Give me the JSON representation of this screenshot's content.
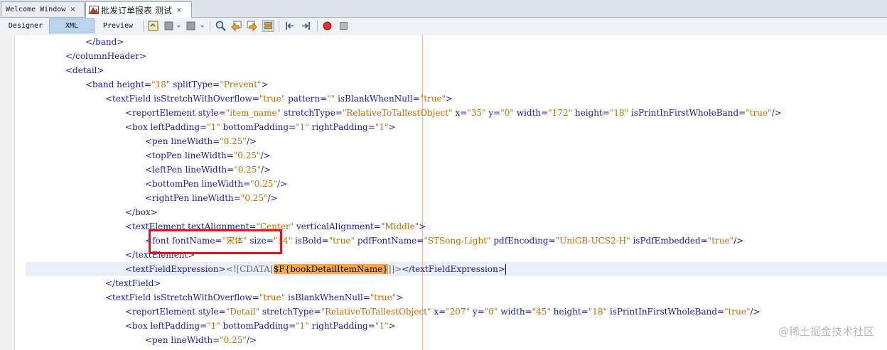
{
  "tabs": [
    {
      "label": "Welcome Window",
      "close": "×",
      "icon": ""
    },
    {
      "label": "批发订单报表 测试",
      "close": "×",
      "icon": "report-icon"
    }
  ],
  "view_buttons": [
    "Designer",
    "XML",
    "Preview"
  ],
  "selected_view": "XML",
  "toolbar_icons": [
    "source-icon",
    "insert-icon",
    "insert-dropdown-icon",
    "insert2-icon",
    "insert2-dropdown-icon",
    "find-icon",
    "find-prev-icon",
    "find-next-icon",
    "toggle-highlight-icon",
    "shift-left-icon",
    "shift-right-icon",
    "record-macro-icon",
    "stop-macro-icon"
  ],
  "code_lines": [
    {
      "indent": "            ",
      "parts": [
        [
          "t",
          "</band>"
        ]
      ]
    },
    {
      "indent": "        ",
      "parts": [
        [
          "t",
          "</columnHeader>"
        ]
      ]
    },
    {
      "indent": "        ",
      "parts": [
        [
          "t",
          "<detail>"
        ]
      ]
    },
    {
      "indent": "            ",
      "parts": [
        [
          "t",
          "<band "
        ],
        [
          "a",
          "height="
        ],
        [
          "v",
          "\"18\""
        ],
        [
          "a",
          " splitType="
        ],
        [
          "v",
          "\"Prevent\""
        ],
        [
          "t",
          ">"
        ]
      ]
    },
    {
      "indent": "                ",
      "parts": [
        [
          "t",
          "<textField "
        ],
        [
          "a",
          "isStretchWithOverflow="
        ],
        [
          "v",
          "\"true\""
        ],
        [
          "a",
          " pattern="
        ],
        [
          "v",
          "\"\""
        ],
        [
          "a",
          " isBlankWhenNull="
        ],
        [
          "v",
          "\"true\""
        ],
        [
          "t",
          ">"
        ]
      ]
    },
    {
      "indent": "                    ",
      "parts": [
        [
          "t",
          "<reportElement "
        ],
        [
          "a",
          "style="
        ],
        [
          "v",
          "\"item_name\""
        ],
        [
          "a",
          " stretchType="
        ],
        [
          "v",
          "\"RelativeToTallestObject\""
        ],
        [
          "a",
          " x="
        ],
        [
          "v",
          "\"35\""
        ],
        [
          "a",
          " y="
        ],
        [
          "v",
          "\"0\""
        ],
        [
          "a",
          " width="
        ],
        [
          "v",
          "\"172\""
        ],
        [
          "a",
          " height="
        ],
        [
          "v",
          "\"18\""
        ],
        [
          "a",
          " isPrintInFirstWholeBand="
        ],
        [
          "v",
          "\"true\""
        ],
        [
          "t",
          "/>"
        ]
      ]
    },
    {
      "indent": "                    ",
      "parts": [
        [
          "t",
          "<box "
        ],
        [
          "a",
          "leftPadding="
        ],
        [
          "v",
          "\"1\""
        ],
        [
          "a",
          " bottomPadding="
        ],
        [
          "v",
          "\"1\""
        ],
        [
          "a",
          " rightPadding="
        ],
        [
          "v",
          "\"1\""
        ],
        [
          "t",
          ">"
        ]
      ]
    },
    {
      "indent": "                        ",
      "parts": [
        [
          "t",
          "<pen "
        ],
        [
          "a",
          "lineWidth="
        ],
        [
          "v",
          "\"0.25\""
        ],
        [
          "t",
          "/>"
        ]
      ]
    },
    {
      "indent": "                        ",
      "parts": [
        [
          "t",
          "<topPen "
        ],
        [
          "a",
          "lineWidth="
        ],
        [
          "v",
          "\"0.25\""
        ],
        [
          "t",
          "/>"
        ]
      ]
    },
    {
      "indent": "                        ",
      "parts": [
        [
          "t",
          "<leftPen "
        ],
        [
          "a",
          "lineWidth="
        ],
        [
          "v",
          "\"0.25\""
        ],
        [
          "t",
          "/>"
        ]
      ]
    },
    {
      "indent": "                        ",
      "parts": [
        [
          "t",
          "<bottomPen "
        ],
        [
          "a",
          "lineWidth="
        ],
        [
          "v",
          "\"0.25\""
        ],
        [
          "t",
          "/>"
        ]
      ]
    },
    {
      "indent": "                        ",
      "parts": [
        [
          "t",
          "<rightPen "
        ],
        [
          "a",
          "lineWidth="
        ],
        [
          "v",
          "\"0.25\""
        ],
        [
          "t",
          "/>"
        ]
      ]
    },
    {
      "indent": "                    ",
      "parts": [
        [
          "t",
          "</box>"
        ]
      ]
    },
    {
      "indent": "                    ",
      "parts": [
        [
          "t",
          "<textElement "
        ],
        [
          "a",
          "textAlignment="
        ],
        [
          "v",
          "\"Center\""
        ],
        [
          "a",
          " verticalAlignment="
        ],
        [
          "v",
          "\"Middle\""
        ],
        [
          "t",
          ">"
        ]
      ]
    },
    {
      "indent": "                        ",
      "parts": [
        [
          "t",
          "<font "
        ],
        [
          "a",
          "fontName="
        ],
        [
          "v",
          "\"宋体\""
        ],
        [
          "a",
          " size="
        ],
        [
          "v",
          "\"14\""
        ],
        [
          "a",
          " isBold="
        ],
        [
          "v",
          "\"true\""
        ],
        [
          "a",
          " pdfFontName="
        ],
        [
          "v",
          "\"STSong-Light\""
        ],
        [
          "a",
          " pdfEncoding="
        ],
        [
          "v",
          "\"UniGB-UCS2-H\""
        ],
        [
          "a",
          " isPdfEmbedded="
        ],
        [
          "v",
          "\"true\""
        ],
        [
          "t",
          "/>"
        ]
      ]
    },
    {
      "indent": "                    ",
      "parts": [
        [
          "t",
          "</textElement>"
        ]
      ]
    },
    {
      "indent": "                    ",
      "parts": [
        [
          "t",
          "<textFieldExpression>"
        ],
        [
          "cd",
          "<![CDATA["
        ],
        [
          "expr",
          "$F{bookDetailItemName}"
        ],
        [
          "cd",
          "]]>"
        ],
        [
          "t",
          "</textFieldExpression>"
        ]
      ]
    },
    {
      "indent": "                ",
      "parts": [
        [
          "t",
          "</textField>"
        ]
      ]
    },
    {
      "indent": "                ",
      "parts": [
        [
          "t",
          "<textField "
        ],
        [
          "a",
          "isStretchWithOverflow="
        ],
        [
          "v",
          "\"true\""
        ],
        [
          "a",
          " isBlankWhenNull="
        ],
        [
          "v",
          "\"true\""
        ],
        [
          "t",
          ">"
        ]
      ]
    },
    {
      "indent": "                    ",
      "parts": [
        [
          "t",
          "<reportElement "
        ],
        [
          "a",
          "style="
        ],
        [
          "v",
          "\"Detail\""
        ],
        [
          "a",
          " stretchType="
        ],
        [
          "v",
          "\"RelativeToTallestObject\""
        ],
        [
          "a",
          " x="
        ],
        [
          "v",
          "\"207\""
        ],
        [
          "a",
          " y="
        ],
        [
          "v",
          "\"0\""
        ],
        [
          "a",
          " width="
        ],
        [
          "v",
          "\"45\""
        ],
        [
          "a",
          " height="
        ],
        [
          "v",
          "\"18\""
        ],
        [
          "a",
          " isPrintInFirstWholeBand="
        ],
        [
          "v",
          "\"true\""
        ],
        [
          "t",
          "/>"
        ]
      ]
    },
    {
      "indent": "                    ",
      "parts": [
        [
          "t",
          "<box "
        ],
        [
          "a",
          "leftPadding="
        ],
        [
          "v",
          "\"1\""
        ],
        [
          "a",
          " bottomPadding="
        ],
        [
          "v",
          "\"1\""
        ],
        [
          "a",
          " rightPadding="
        ],
        [
          "v",
          "\"1\""
        ],
        [
          "t",
          ">"
        ]
      ]
    },
    {
      "indent": "                        ",
      "parts": [
        [
          "t",
          "<pen "
        ],
        [
          "a",
          "lineWidth="
        ],
        [
          "v",
          "\"0.25\""
        ],
        [
          "t",
          "/>"
        ]
      ]
    }
  ],
  "watermark": "@稀土掘金技术社区",
  "colors": {
    "tag": "#1a1aa8",
    "value": "#c66a00",
    "highlight": "#f7a64b",
    "annotation": "#e1141b"
  }
}
